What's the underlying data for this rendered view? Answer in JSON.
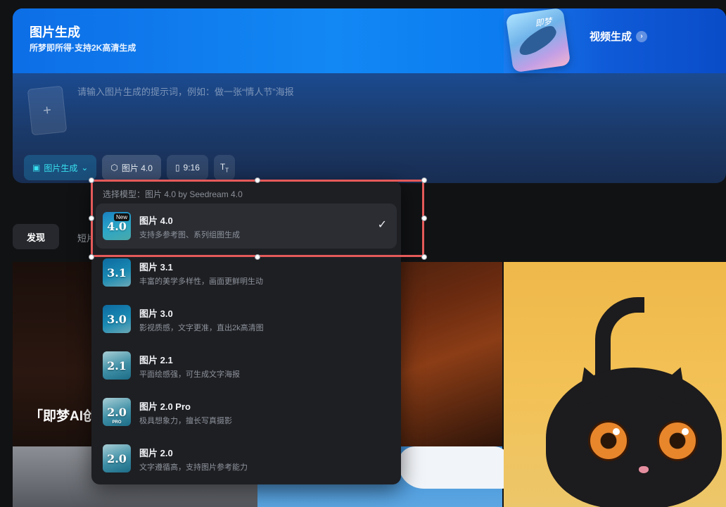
{
  "hero": {
    "title": "图片生成",
    "subtitle": "所梦即所得·支持2K高清生成",
    "video_card": {
      "thumb_label": "即梦",
      "label": "视频生成"
    },
    "prompt_placeholder": "请输入图片生成的提示词，例如：做一张“情人节”海报",
    "upload_icon": "plus-icon",
    "toolbar": {
      "mode_label": "图片生成",
      "model_label": "图片 4.0",
      "ratio_label": "9:16",
      "text_tool_icon": "text-size-icon"
    }
  },
  "tabs": {
    "discover": "发现",
    "short": "短片"
  },
  "gallery": {
    "featured_text": "「即梦AI创"
  },
  "dropdown": {
    "header": "选择模型：图片 4.0 by Seedream 4.0",
    "items": [
      {
        "name": "图片 4.0",
        "desc": "支持多参考图、系列组图生成",
        "thumb": "4.0",
        "badge": "New",
        "selected": true
      },
      {
        "name": "图片 3.1",
        "desc": "丰富的美学多样性，画面更鲜明生动",
        "thumb": "3.1"
      },
      {
        "name": "图片 3.0",
        "desc": "影视质感，文字更准，直出2k高清图",
        "thumb": "3.0"
      },
      {
        "name": "图片 2.1",
        "desc": "平面绘感强，可生成文字海报",
        "thumb": "2.1"
      },
      {
        "name": "图片 2.0 Pro",
        "desc": "极具想象力，擅长写真摄影",
        "thumb": "2.0",
        "thumb_tag": "PRO"
      },
      {
        "name": "图片 2.0",
        "desc": "文字遵循高，支持图片参考能力",
        "thumb": "2.0"
      }
    ]
  },
  "colors": {
    "accent": "#38e0f0",
    "selection": "#e55a5a",
    "panel": "#1e1f23"
  }
}
